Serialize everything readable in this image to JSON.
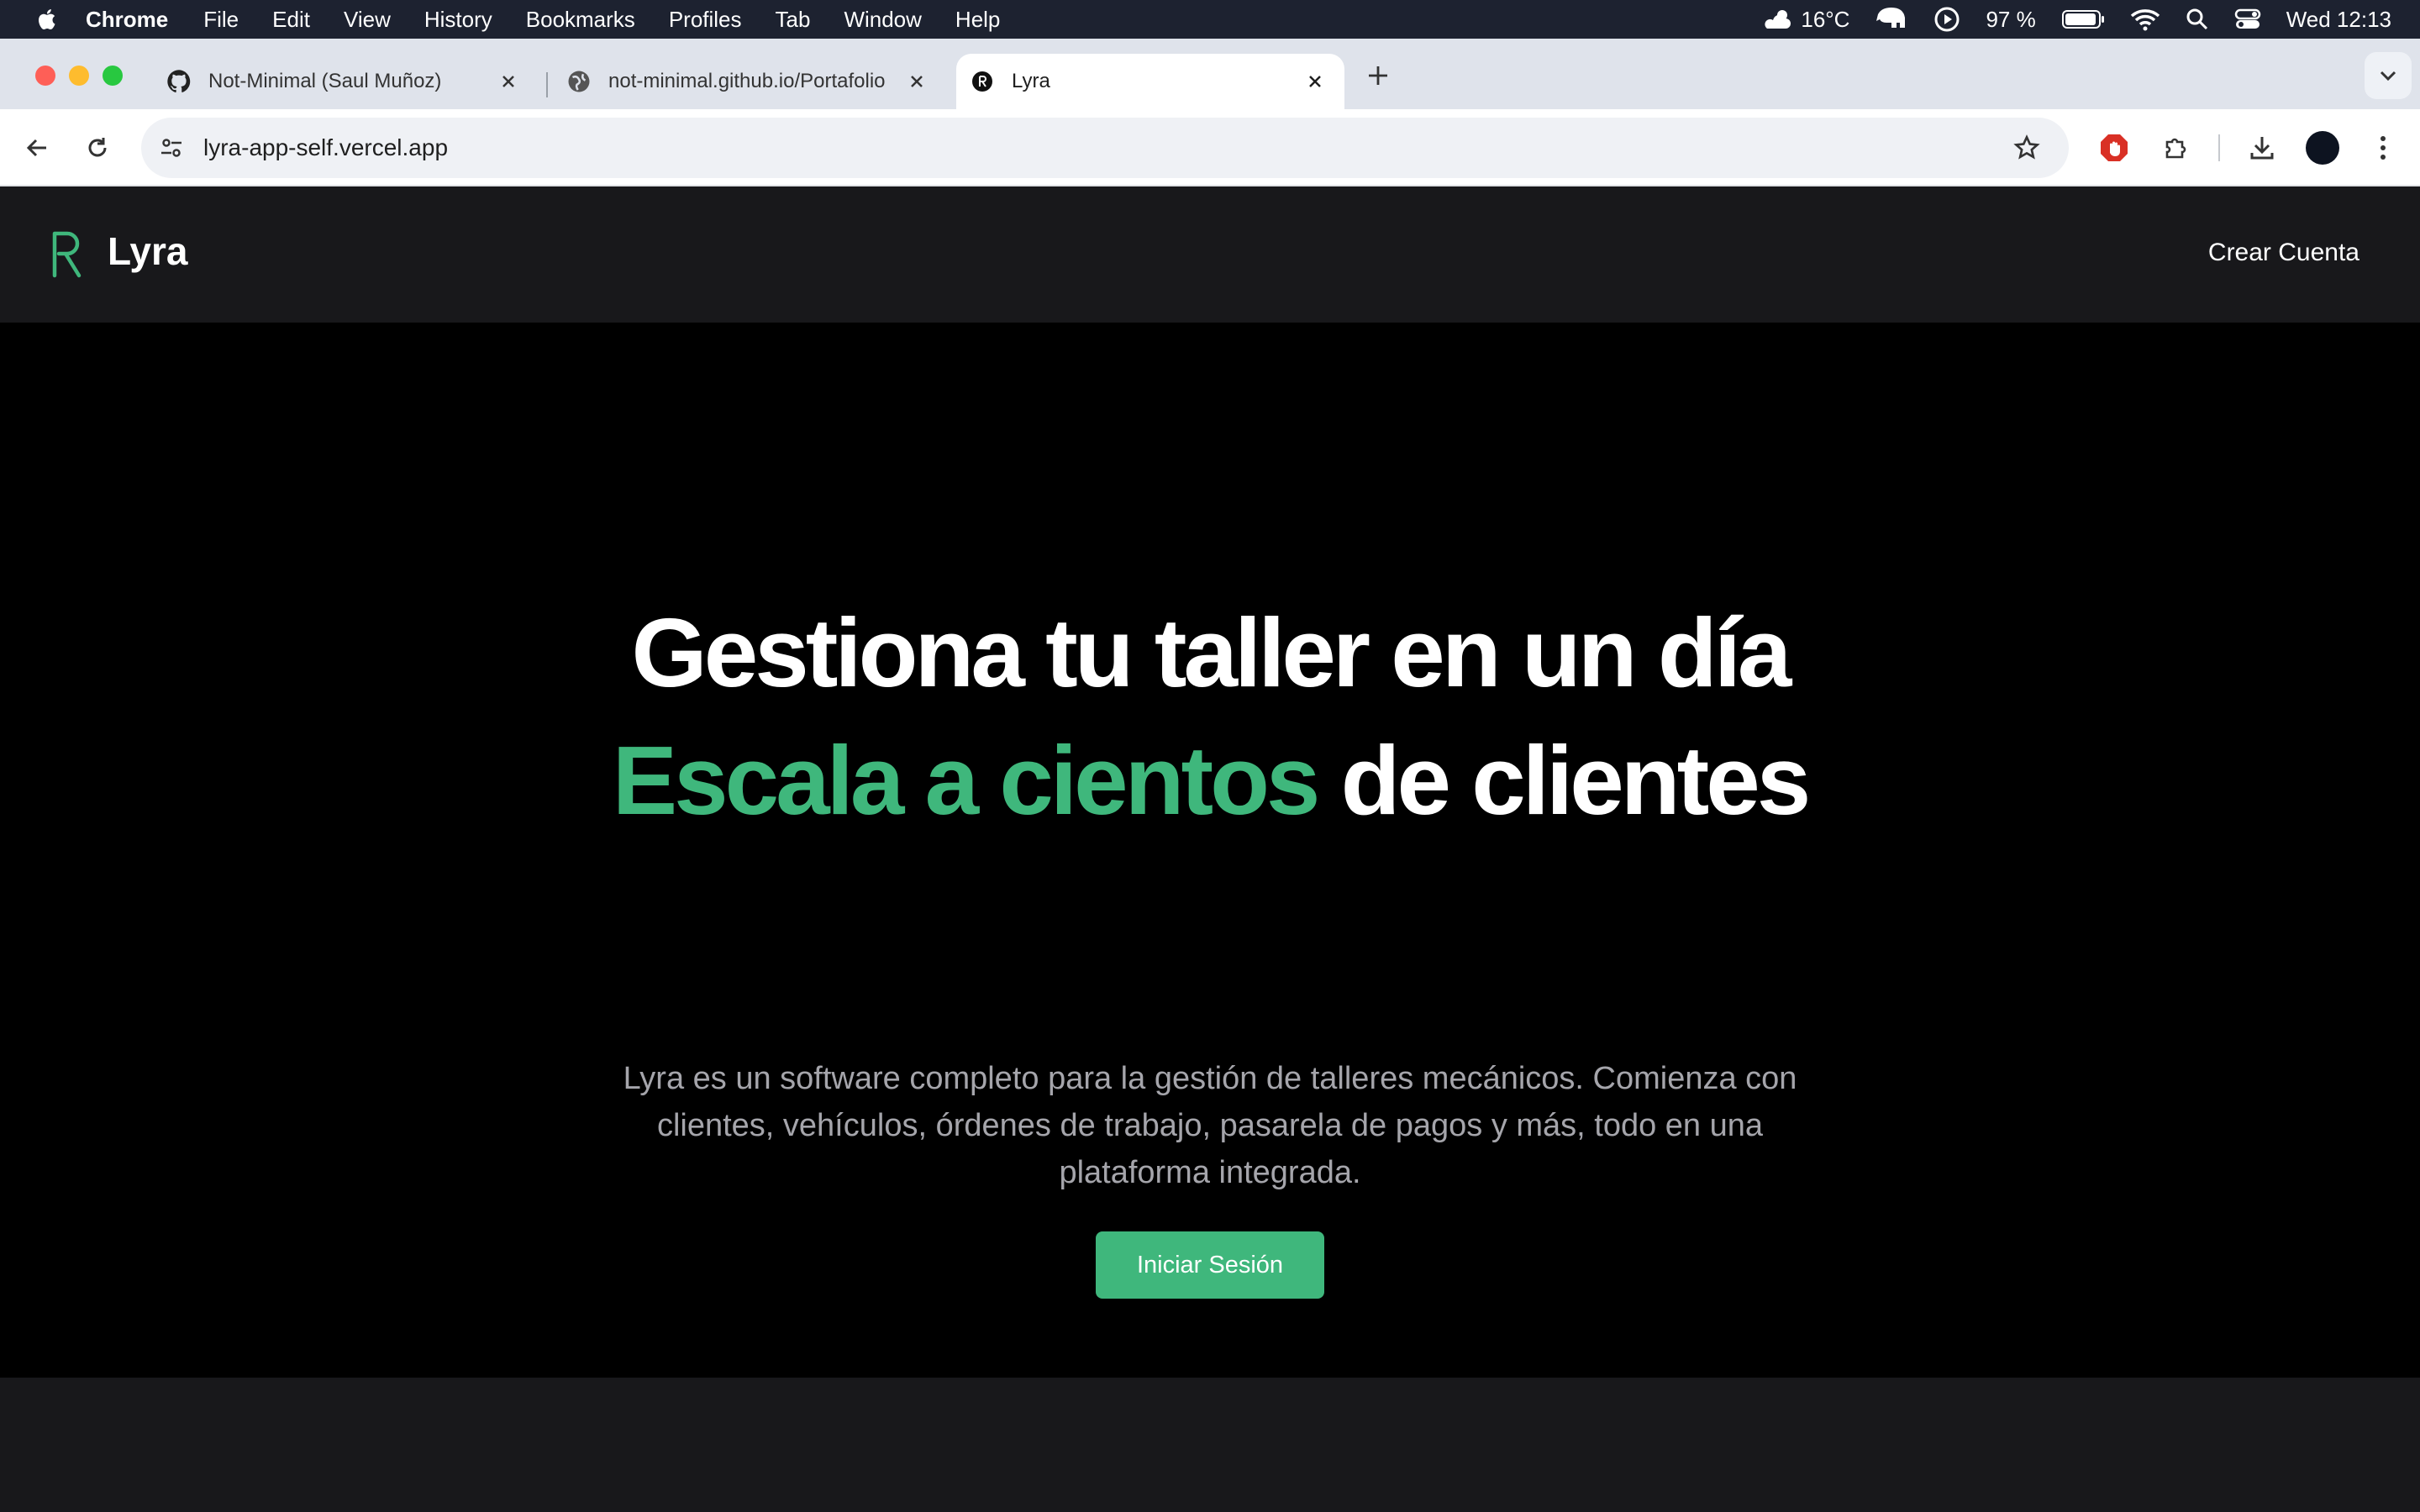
{
  "menubar": {
    "app_name": "Chrome",
    "items": [
      "File",
      "Edit",
      "View",
      "History",
      "Bookmarks",
      "Profiles",
      "Tab",
      "Window",
      "Help"
    ],
    "weather": "16°C",
    "battery": "97 %",
    "clock": "Wed 12:13"
  },
  "tabs": [
    {
      "title": "Not-Minimal (Saul Muñoz)",
      "icon": "github-icon"
    },
    {
      "title": "not-minimal.github.io/Portafolio",
      "icon": "globe-icon"
    },
    {
      "title": "Lyra",
      "icon": "lyra-favicon",
      "active": true
    }
  ],
  "toolbar": {
    "url": "lyra-app-self.vercel.app"
  },
  "site": {
    "brand": "Lyra",
    "nav_link": "Crear Cuenta",
    "headline_line1": "Gestiona tu taller en un día",
    "headline_accent": "Escala a cientos",
    "headline_line2_rest": " de clientes",
    "subtitle": "Lyra es un software completo para la gestión de talleres mecánicos. Comienza con clientes, vehículos, órdenes de trabajo, pasarela de pagos y más, todo en una plataforma integrada.",
    "cta_label": "Iniciar Sesión"
  },
  "colors": {
    "accent": "#3fb77c",
    "nav_bg": "#18181b",
    "page_bg": "#000000"
  }
}
